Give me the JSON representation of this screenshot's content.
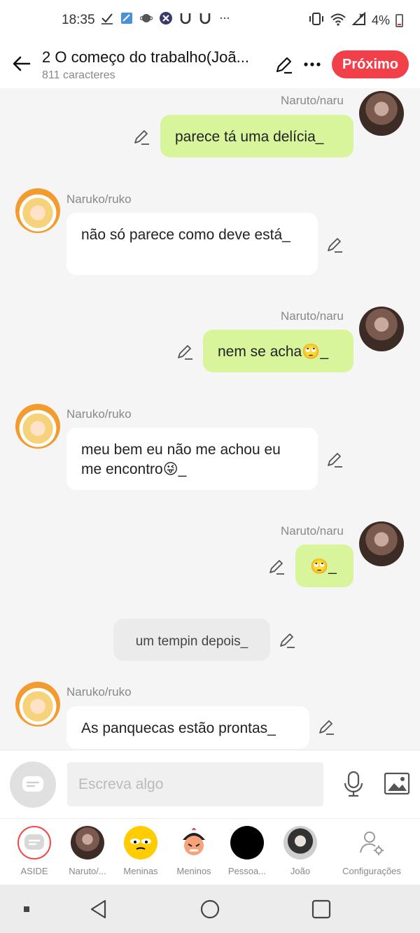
{
  "status_bar": {
    "time": "18:35",
    "battery": "4%"
  },
  "header": {
    "title": "2 O começo do trabalho(Joã...",
    "subtitle": "811 caracteres",
    "next_label": "Próximo"
  },
  "messages": [
    {
      "speaker": "Naruto/naru",
      "text": "parece tá uma delícia_"
    },
    {
      "speaker": "Naruko/ruko",
      "text": "não só parece como deve está_"
    },
    {
      "speaker": "Naruto/naru",
      "text": "nem se acha🙄_"
    },
    {
      "speaker": "Naruko/ruko",
      "text": "meu bem eu não me achou eu me encontro😜_"
    },
    {
      "speaker": "Naruto/naru",
      "text": "🙄_"
    },
    {
      "speaker": "",
      "text": "um tempin depois_"
    },
    {
      "speaker": "Naruko/ruko",
      "text": "As panquecas estão prontas_"
    }
  ],
  "input": {
    "placeholder": "Escreva algo"
  },
  "characters": [
    {
      "label": "ASIDE"
    },
    {
      "label": "Naruto/..."
    },
    {
      "label": "Meninas"
    },
    {
      "label": "Meninos"
    },
    {
      "label": "Pessoa..."
    },
    {
      "label": "João"
    },
    {
      "label": "Configurações"
    }
  ]
}
